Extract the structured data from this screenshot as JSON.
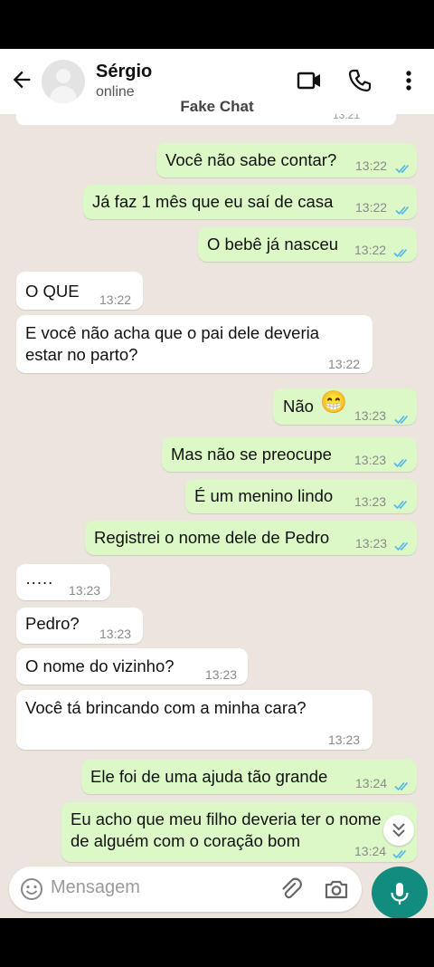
{
  "header": {
    "contact_name": "Sérgio",
    "contact_status": "online",
    "overlay_label": "Fake Chat"
  },
  "partial_time": "13:21",
  "messages": [
    {
      "dir": "out",
      "text": "Você não sabe contar?",
      "time": "13:22",
      "read": true
    },
    {
      "dir": "out",
      "text": "Já faz 1 mês que eu saí de casa",
      "time": "13:22",
      "read": true
    },
    {
      "dir": "out",
      "text": "O bebê já nasceu",
      "time": "13:22",
      "read": true
    },
    {
      "dir": "in",
      "text": "O QUE",
      "time": "13:22"
    },
    {
      "dir": "in",
      "lines": [
        "E você não acha que o pai dele deveria",
        "estar no parto?"
      ],
      "time": "13:22"
    },
    {
      "dir": "out",
      "text": "Não",
      "emoji": "😁",
      "time": "13:23",
      "read": true
    },
    {
      "dir": "out",
      "text": "Mas não se preocupe",
      "time": "13:23",
      "read": true
    },
    {
      "dir": "out",
      "text": "É um menino lindo",
      "time": "13:23",
      "read": true
    },
    {
      "dir": "out",
      "text": "Registrei o nome dele de Pedro",
      "time": "13:23",
      "read": true
    },
    {
      "dir": "in",
      "text": "·····",
      "time": "13:23"
    },
    {
      "dir": "in",
      "text": "Pedro?",
      "time": "13:23"
    },
    {
      "dir": "in",
      "text": "O nome do vizinho?",
      "time": "13:23"
    },
    {
      "dir": "in",
      "text": "Você tá brincando com a minha cara?",
      "time": "13:23"
    },
    {
      "dir": "out",
      "text": "Ele foi de uma ajuda tão grande",
      "time": "13:24",
      "read": true
    },
    {
      "dir": "out",
      "lines": [
        "Eu acho que meu filho deveria ter o nome",
        "de alguém com o coração bom"
      ],
      "time": "13:24",
      "read": true
    }
  ],
  "composer": {
    "placeholder": "Mensagem"
  },
  "colors": {
    "read_ticks": "#4fb6ec",
    "outgoing_bubble": "#dcf8c6",
    "incoming_bubble": "#ffffff",
    "accent": "#128c7e",
    "chat_bg": "#ece5dd"
  },
  "icons": [
    "back-arrow-icon",
    "video-call-icon",
    "phone-icon",
    "more-vert-icon",
    "emoji-icon",
    "attach-icon",
    "camera-icon",
    "mic-icon",
    "double-chevron-down-icon"
  ]
}
